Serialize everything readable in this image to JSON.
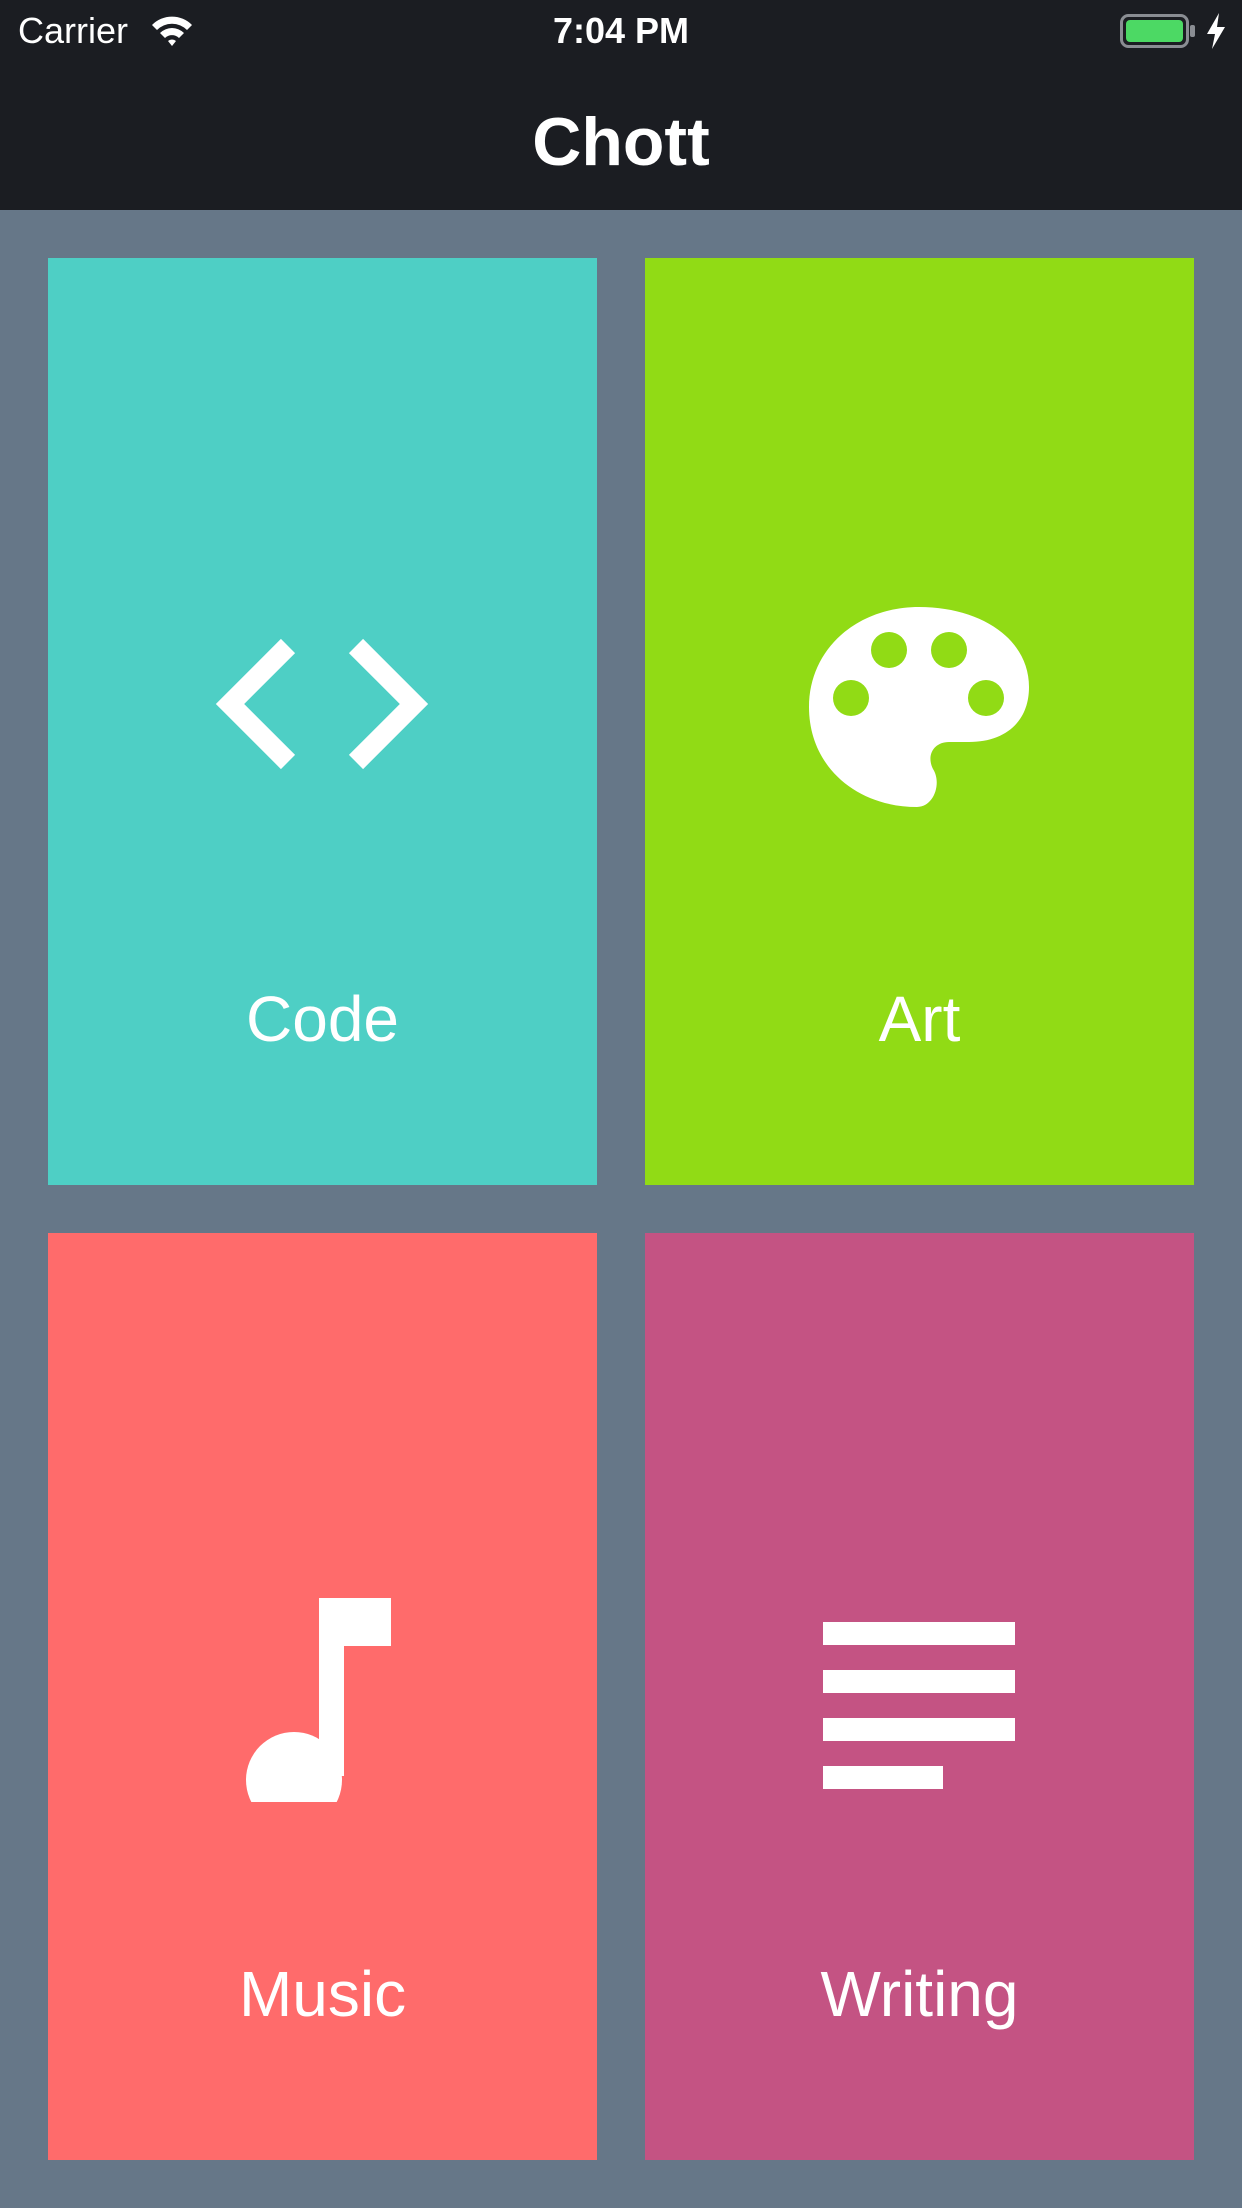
{
  "status_bar": {
    "carrier": "Carrier",
    "time": "7:04 PM"
  },
  "nav": {
    "title": "Chott"
  },
  "categories": [
    {
      "label": "Code",
      "icon": "code-brackets-icon",
      "color": "#4ecfc5"
    },
    {
      "label": "Art",
      "icon": "palette-icon",
      "color": "#91db15"
    },
    {
      "label": "Music",
      "icon": "music-note-icon",
      "color": "#ff6b6b"
    },
    {
      "label": "Writing",
      "icon": "text-lines-icon",
      "color": "#c45383"
    }
  ],
  "colors": {
    "bar_background": "#1b1d22",
    "grid_background": "#667788",
    "battery_fill": "#4cd964"
  }
}
